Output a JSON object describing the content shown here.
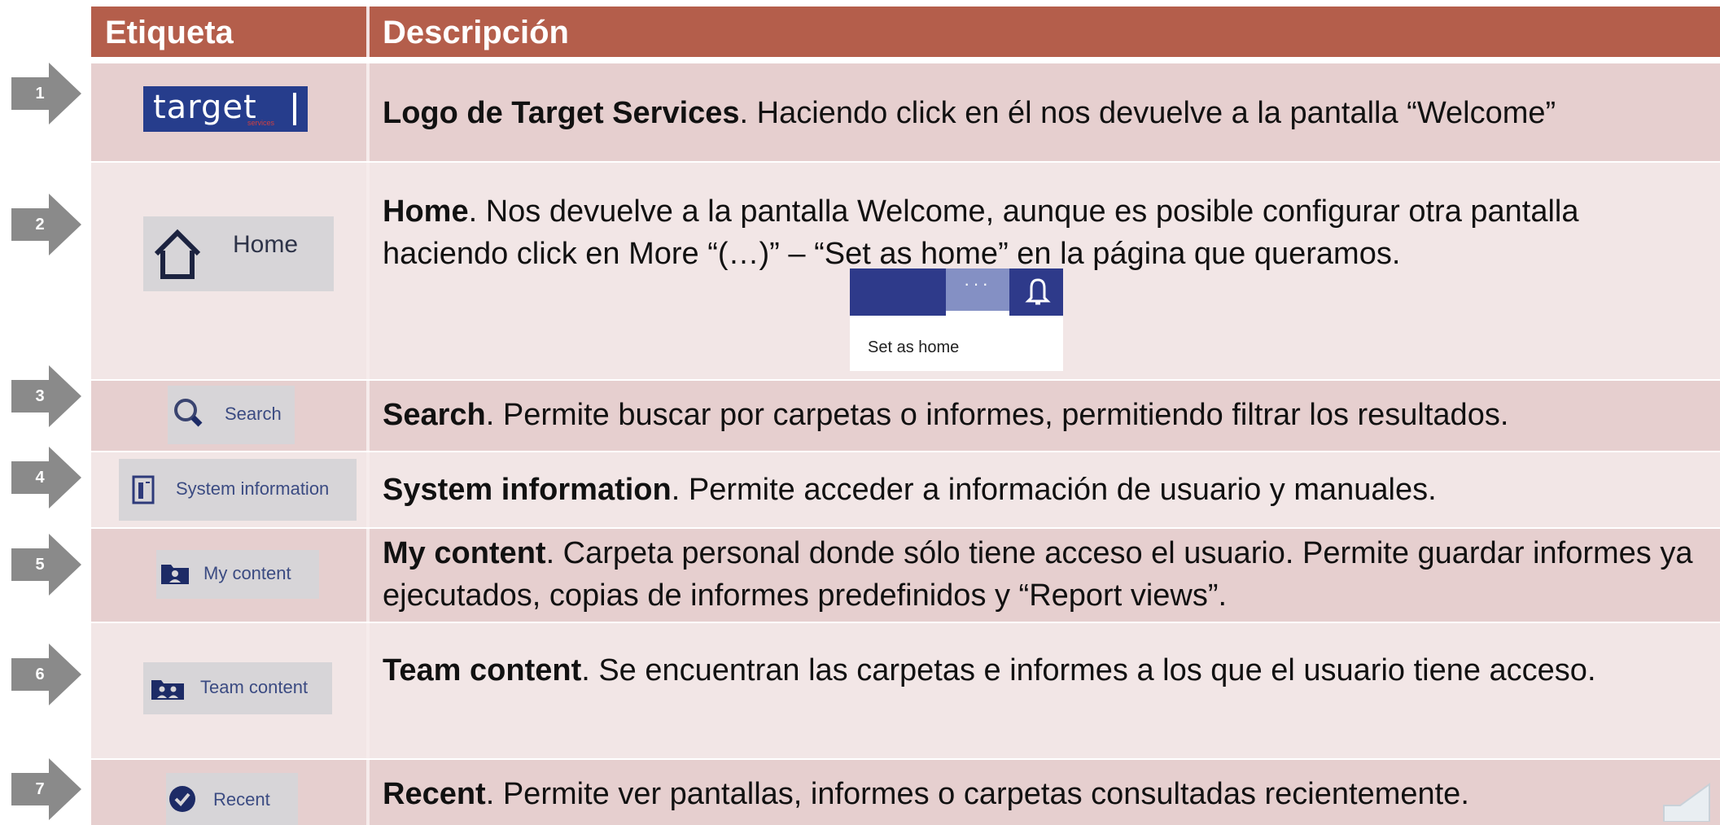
{
  "table": {
    "header": {
      "label_col": "Etiqueta",
      "desc_col": "Descripción"
    },
    "rows": [
      {
        "num": "1",
        "title": "Logo de Target Services",
        "text": ". Haciendo click en él nos devuelve a la pantalla “Welcome”",
        "logo_text": "target",
        "logo_sub": "services"
      },
      {
        "num": "2",
        "title": "Home",
        "text": ". Nos devuelve a la pantalla Welcome, aunque es posible configurar otra pantalla haciendo click en More “(…)” – “Set as home” en la página que queramos.",
        "thumb_label": "Home",
        "menu_dots": "···",
        "menu_item": "Set as home"
      },
      {
        "num": "3",
        "title": "Search",
        "text": ". Permite buscar por carpetas o informes, permitiendo filtrar los resultados.",
        "thumb_label": "Search"
      },
      {
        "num": "4",
        "title": "System information",
        "text": ". Permite acceder a información de usuario y manuales.",
        "thumb_label": "System information"
      },
      {
        "num": "5",
        "title": "My content",
        "text": ". Carpeta personal donde sólo tiene acceso el usuario. Permite guardar informes ya ejecutados, copias de informes predefinidos y “Report views”.",
        "thumb_label": "My content"
      },
      {
        "num": "6",
        "title": "Team content",
        "text": ". Se encuentran las carpetas e informes a los que el usuario tiene acceso.",
        "thumb_label": "Team content"
      },
      {
        "num": "7",
        "title": "Recent",
        "text": ". Permite ver pantallas, informes o carpetas consultadas recientemente.",
        "thumb_label": "Recent"
      }
    ]
  },
  "icons": {
    "marker": "arrow-marker-icon",
    "home": "house-icon",
    "bell": "bell-icon",
    "search": "magnifier-icon",
    "system_information": "document-icon",
    "my_content": "user-folder-icon",
    "team_content": "team-folder-icon",
    "recent": "clock-check-icon",
    "speaker": "speaker-icon"
  },
  "colors": {
    "header": "#b45e4b",
    "row_dark": "#e6cfcf",
    "row_light": "#f2e6e6",
    "marker": "#8a8a8a",
    "brand_blue": "#263d8c"
  }
}
